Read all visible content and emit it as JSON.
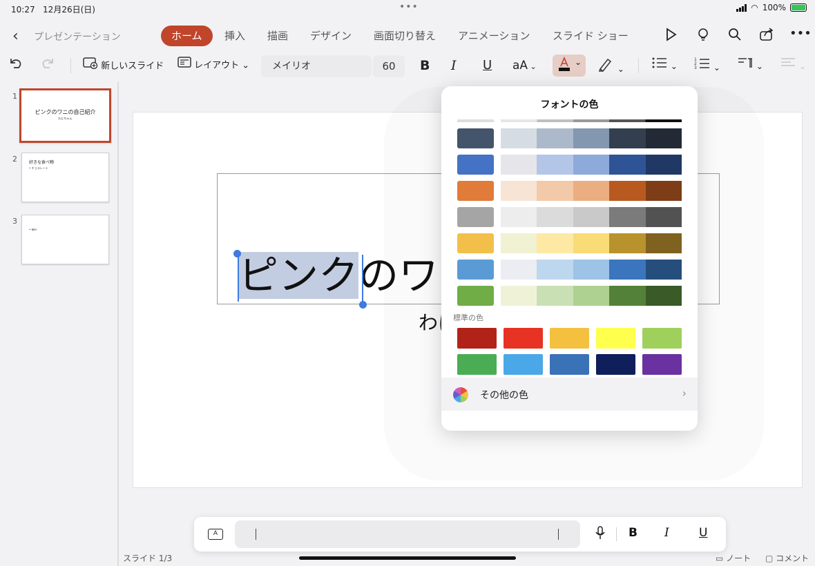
{
  "status": {
    "time": "10:27",
    "date": "12月26日(日)",
    "battery": "100%"
  },
  "nav": {
    "back_label": "プレゼンテーション"
  },
  "tabs": [
    "ホーム",
    "挿入",
    "描画",
    "デザイン",
    "画面切り替え",
    "アニメーション",
    "スライド ショー"
  ],
  "toolbar": {
    "new_slide": "新しいスライド",
    "layout": "レイアウト",
    "font_name": "メイリオ",
    "font_size": "60"
  },
  "slides": [
    {
      "num": "1",
      "title": "ピンクのワニの自己紹介",
      "sub": "わにちゃん"
    },
    {
      "num": "2",
      "title": "好きな食べ物",
      "sub": "• チョコレート"
    },
    {
      "num": "3",
      "title": "",
      "sub": "• Ыer"
    }
  ],
  "slide_counter": "スライド 1/3",
  "canvas": {
    "title_selected": "ピンク",
    "title_rest": "のワ",
    "subtitle": "わに"
  },
  "popover": {
    "title": "フォントの色",
    "theme_rows": [
      [
        "#44546a",
        "#d6dce4",
        "#acb9ca",
        "#8497b0",
        "#333f4f",
        "#222a35"
      ],
      [
        "#4472c4",
        "#e6e6ea",
        "#b4c6e7",
        "#8eaadb",
        "#2f5496",
        "#203864"
      ],
      [
        "#e07b39",
        "#f8e4d4",
        "#f2c9a9",
        "#ebae80",
        "#b85a20",
        "#7e3d16"
      ],
      [
        "#a5a5a5",
        "#ededed",
        "#dbdbdb",
        "#c9c9c9",
        "#7b7b7b",
        "#525252"
      ],
      [
        "#f2c04a",
        "#f1f1d4",
        "#fde9a3",
        "#f9db77",
        "#b8922d",
        "#7f6120"
      ],
      [
        "#5b9bd5",
        "#ecedf2",
        "#bdd7ee",
        "#9dc3e6",
        "#3a75bd",
        "#254e7d"
      ],
      [
        "#70ad47",
        "#f0f2d8",
        "#c9e0b4",
        "#aed191",
        "#53813a",
        "#3a5a28"
      ]
    ],
    "standard_label": "標準の色",
    "standard_colors": [
      [
        "#b12318",
        "#e63324",
        "#f3c040",
        "#ffff4d",
        "#9fd05c"
      ],
      [
        "#4aad53",
        "#4aa8e8",
        "#3a72b8",
        "#0e1f5b",
        "#6a32a0"
      ]
    ],
    "more_colors": "その他の色"
  },
  "bottom": {
    "notes": "ノート",
    "comments": "コメント"
  }
}
